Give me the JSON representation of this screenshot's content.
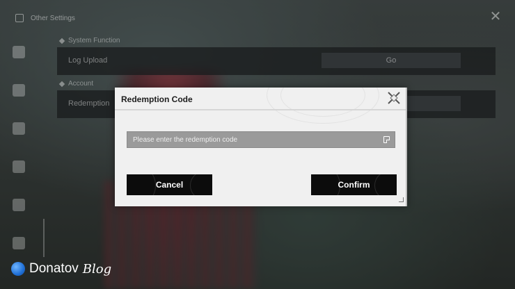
{
  "background": {
    "window_title": "Other Settings",
    "close_icon": "close-x-icon",
    "sidebar_icons": [
      "music-icon",
      "inbox-icon",
      "shield-icon",
      "gamepad-icon",
      "keyboard-icon",
      "lock-icon"
    ],
    "sections": [
      {
        "title": "System Function",
        "rows": [
          {
            "label": "Log Upload",
            "value": "Go"
          }
        ]
      },
      {
        "title": "Account",
        "rows": [
          {
            "label": "Redemption",
            "value": ""
          }
        ]
      }
    ]
  },
  "modal": {
    "title": "Redemption Code",
    "input_placeholder": "Please enter the redemption code",
    "input_value": "",
    "paste_icon": "paste-icon",
    "cancel_label": "Cancel",
    "confirm_label": "Confirm",
    "colors": {
      "panel": "#f0f0f0",
      "button": "#0c0c0c",
      "input": "#9a9a9a"
    }
  },
  "watermark": {
    "brand": "Donatov",
    "suffix": "Blog"
  }
}
